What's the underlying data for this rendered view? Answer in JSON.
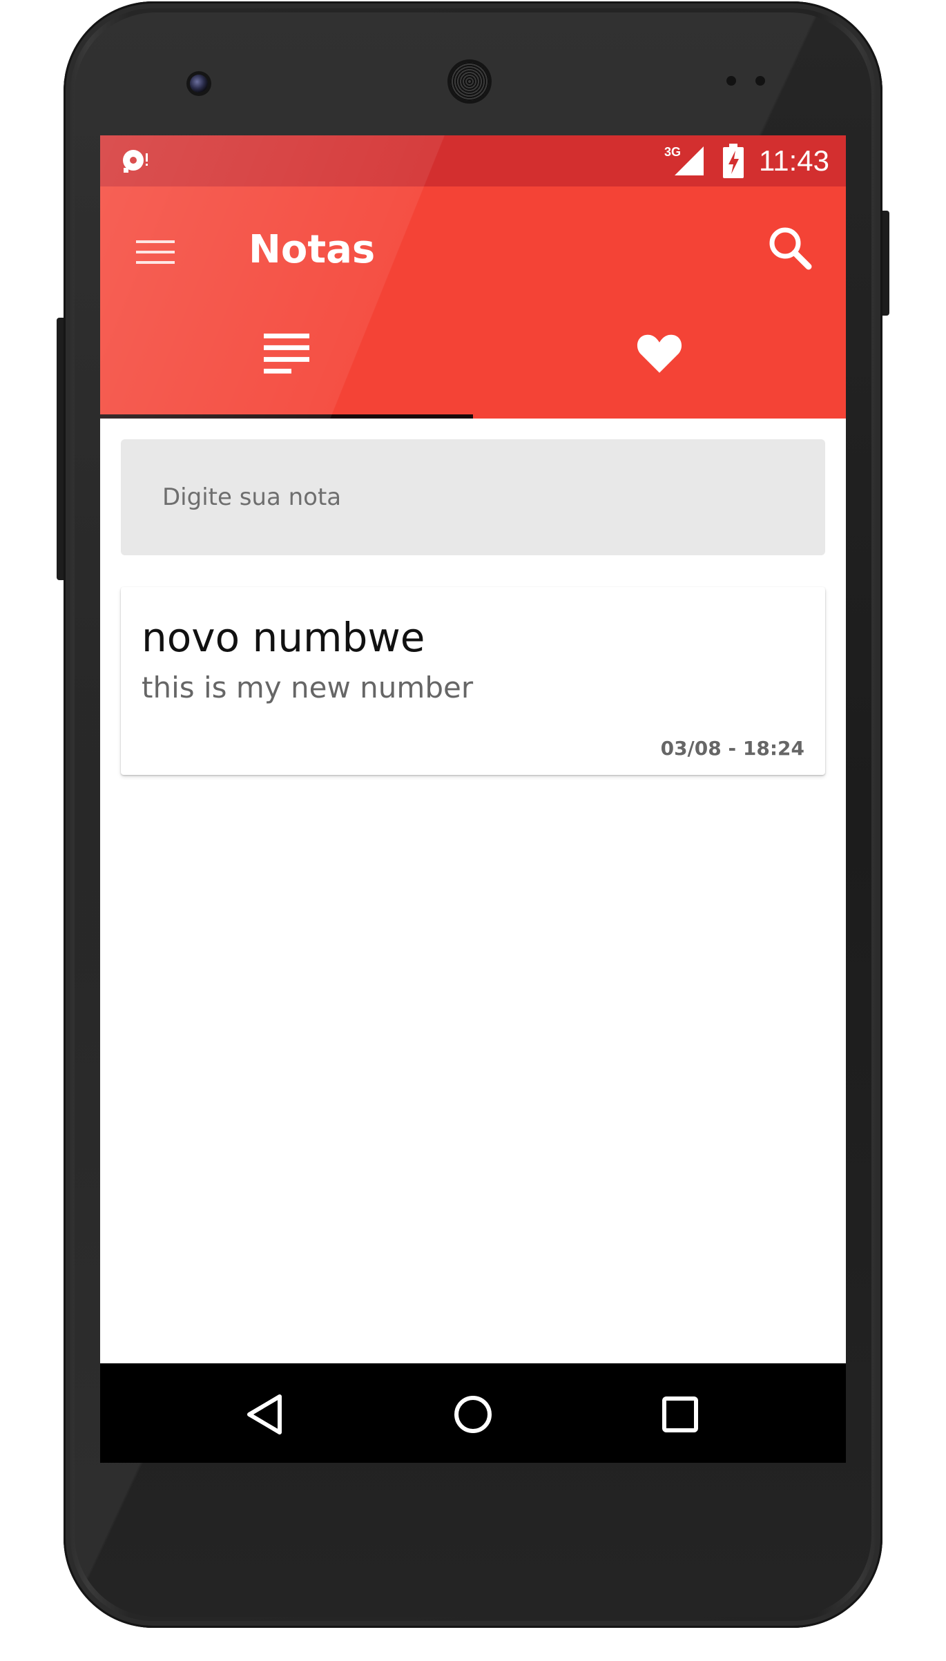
{
  "status_bar": {
    "time": "11:43",
    "network_type": "3G",
    "icons": [
      "screen-recorder-icon",
      "signal-icon",
      "battery-charging-icon"
    ]
  },
  "app_bar": {
    "title": "Notas",
    "menu_icon": "hamburger-menu-icon",
    "search_icon": "search-icon"
  },
  "tabs": [
    {
      "icon": "notes-list-icon",
      "selected": true
    },
    {
      "icon": "heart-icon",
      "selected": false
    }
  ],
  "note_input": {
    "placeholder": "Digite sua nota",
    "value": ""
  },
  "notes": [
    {
      "title": "novo numbwe",
      "body": "this is my new number",
      "date": "03/08 - 18:24"
    }
  ],
  "nav_bar": {
    "icons": [
      "back-icon",
      "home-icon",
      "recents-icon"
    ]
  },
  "colors": {
    "primary": "#f44336",
    "primary_dark": "#d32f2f",
    "input_background": "#e8e8e8"
  }
}
